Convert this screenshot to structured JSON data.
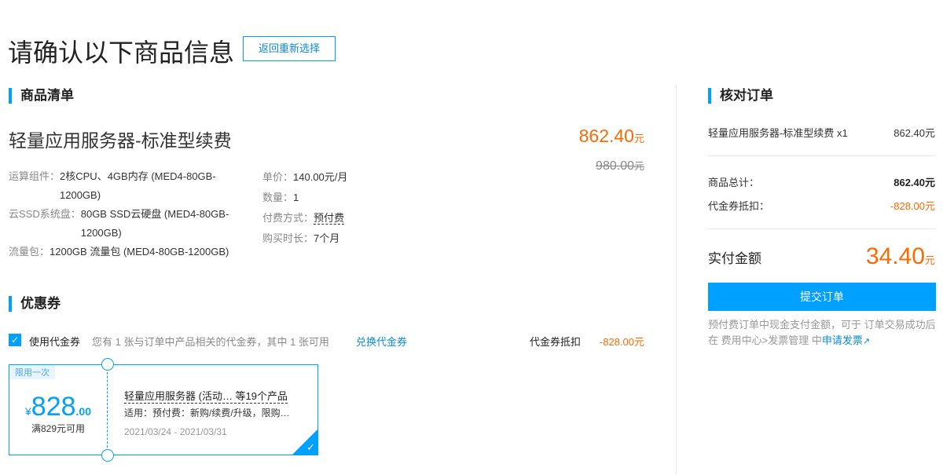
{
  "header": {
    "title": "请确认以下商品信息",
    "back_label": "返回重新选择"
  },
  "goods": {
    "section": "商品清单",
    "name": "轻量应用服务器-标准型续费",
    "price": "862.40",
    "unit": "元",
    "orig_price": "980.00",
    "orig_unit": "元",
    "specs": [
      {
        "label": "运算组件：",
        "value": "2核CPU、4GB内存 (MED4-80GB-1200GB)"
      },
      {
        "label": "云SSD系统盘：",
        "value": "80GB SSD云硬盘 (MED4-80GB-1200GB)"
      },
      {
        "label": "流量包：",
        "value": "1200GB 流量包 (MED4-80GB-1200GB)"
      }
    ],
    "details": [
      {
        "label": "单价：",
        "value": "140.00元/月"
      },
      {
        "label": "数量：",
        "value": "1"
      },
      {
        "label": "付费方式：",
        "value": "预付费"
      },
      {
        "label": "购买时长：",
        "value": "7个月"
      }
    ]
  },
  "coupon": {
    "section": "优惠券",
    "use_label": "使用代金券",
    "info": "您有 1 张与订单中产品相关的代金券，其中 1 张可用",
    "exchange": "兑换代金券",
    "deduct_label": "代金券抵扣",
    "deduct_value": "-828.00元",
    "card": {
      "tag": "限用一次",
      "currency": "¥",
      "amount": "828",
      "decimals": ".00",
      "condition": "满829元可用",
      "name": "轻量应用服务器 (活动… 等19个产品",
      "scope": "适用：预付费：新购/续费/升级，限购…",
      "dates": "2021/03/24 - 2021/03/31"
    }
  },
  "order": {
    "section": "核对订单",
    "item": "轻量应用服务器-标准型续费 x1",
    "item_price": "862.40元",
    "total_label": "商品总计：",
    "total_value": "862.40元",
    "voucher_label": "代金券抵扣：",
    "voucher_value": "-828.00元",
    "pay_label": "实付金额",
    "pay_value": "34.40",
    "pay_unit": "元",
    "submit": "提交订单",
    "note": "预付费订单中现金支付金额，可于 订单交易成功后 在 费用中心>发票管理 中",
    "invoice_link": "申请发票"
  }
}
